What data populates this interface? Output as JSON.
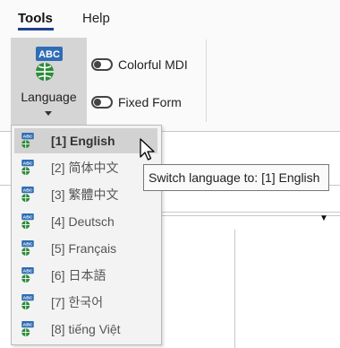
{
  "tabs": [
    {
      "label": "Tools",
      "active": true
    },
    {
      "label": "Help",
      "active": false
    }
  ],
  "ribbon": {
    "language": {
      "label": "Language",
      "icon": "abc-globe-icon"
    },
    "toggles": [
      {
        "label": "Colorful MDI",
        "on": false
      },
      {
        "label": "Fixed Form",
        "on": false
      }
    ]
  },
  "language_menu": {
    "items": [
      {
        "label": "[1] English",
        "highlighted": true
      },
      {
        "label": "[2] 简体中文",
        "highlighted": false
      },
      {
        "label": "[3] 繁體中文",
        "highlighted": false
      },
      {
        "label": "[4] Deutsch",
        "highlighted": false
      },
      {
        "label": "[5] Français",
        "highlighted": false
      },
      {
        "label": "[6] 日本語",
        "highlighted": false
      },
      {
        "label": "[7] 한국어",
        "highlighted": false
      },
      {
        "label": "[8] tiếng Việt",
        "highlighted": false
      }
    ]
  },
  "tooltip": {
    "text": "Switch language to: [1] English"
  },
  "colors": {
    "accent": "#1f3f8f",
    "icon_blue": "#2f6db5",
    "icon_green": "#2e8b3a"
  }
}
